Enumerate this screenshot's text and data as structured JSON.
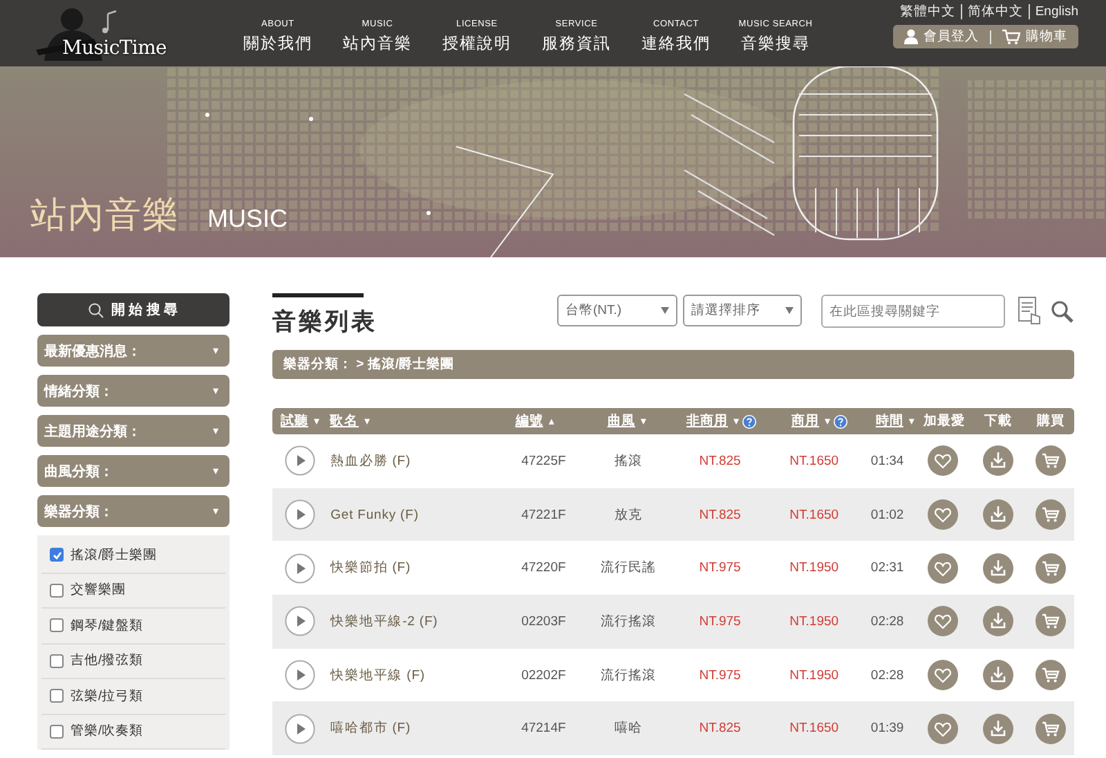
{
  "header": {
    "logo": "MusicTime",
    "nav": [
      {
        "en": "ABOUT",
        "zh": "關於我們"
      },
      {
        "en": "MUSIC",
        "zh": "站內音樂"
      },
      {
        "en": "LICENSE",
        "zh": "授權說明"
      },
      {
        "en": "SERVICE",
        "zh": "服務資訊"
      },
      {
        "en": "CONTACT",
        "zh": "連絡我們"
      },
      {
        "en": "MUSIC SEARCH",
        "zh": "音樂搜尋"
      }
    ],
    "languages": [
      "繁體中文",
      "简体中文",
      "English"
    ],
    "member": "會員登入",
    "cart": "購物車"
  },
  "banner": {
    "title": "站內音樂",
    "subtitle": "MUSIC"
  },
  "sidebar": {
    "search_button": "開 始 搜 尋",
    "categories": [
      {
        "label": "最新優惠消息：",
        "caret": "▾"
      },
      {
        "label": "情緒分類：",
        "caret": "▾"
      },
      {
        "label": "主題用途分類：",
        "caret": "▾"
      },
      {
        "label": "曲風分類：",
        "caret": "▾"
      },
      {
        "label": "樂器分類：",
        "caret": "▾"
      }
    ],
    "options": [
      {
        "label": "搖滾/爵士樂團",
        "checked": true
      },
      {
        "label": "交響樂團",
        "checked": false
      },
      {
        "label": "鋼琴/鍵盤類",
        "checked": false
      },
      {
        "label": "吉他/撥弦類",
        "checked": false
      },
      {
        "label": "弦樂/拉弓類",
        "checked": false
      },
      {
        "label": "管樂/吹奏類",
        "checked": false
      }
    ]
  },
  "main": {
    "title": "音樂列表",
    "currency": {
      "value": "台幣(NT.)"
    },
    "sort": {
      "value": "請選擇排序"
    },
    "search": {
      "placeholder": "在此區搜尋關鍵字"
    },
    "breadcrumb": "樂器分類： > 搖滾/爵士樂團",
    "columns": [
      {
        "label": "試聽",
        "arrow": "▾",
        "link": true,
        "help": false
      },
      {
        "label": "歌名",
        "arrow": "▾",
        "link": true,
        "help": false
      },
      {
        "label": "編號",
        "arrow": "▴",
        "link": true,
        "help": false
      },
      {
        "label": "曲風",
        "arrow": "▾",
        "link": true,
        "help": false
      },
      {
        "label": "非商用",
        "arrow": "▾",
        "link": true,
        "help": true
      },
      {
        "label": "商用",
        "arrow": "▾",
        "link": true,
        "help": true
      },
      {
        "label": "時間",
        "arrow": "▾",
        "link": true,
        "help": false
      },
      {
        "label": "加最愛",
        "link": false,
        "help": false
      },
      {
        "label": "下載",
        "link": false,
        "help": false
      },
      {
        "label": "購買",
        "link": false,
        "help": false
      }
    ],
    "rows": [
      {
        "name": "熱血必勝 (F)",
        "code": "47225F",
        "genre": "搖滾",
        "price_noncommercial": "NT.825",
        "price_commercial": "NT.1650",
        "time": "01:34"
      },
      {
        "name": "Get Funky (F)",
        "code": "47221F",
        "genre": "放克",
        "price_noncommercial": "NT.825",
        "price_commercial": "NT.1650",
        "time": "01:02"
      },
      {
        "name": "快樂節拍 (F)",
        "code": "47220F",
        "genre": "流行民謠",
        "price_noncommercial": "NT.975",
        "price_commercial": "NT.1950",
        "time": "02:31"
      },
      {
        "name": "快樂地平線-2 (F)",
        "code": "02203F",
        "genre": "流行搖滾",
        "price_noncommercial": "NT.975",
        "price_commercial": "NT.1950",
        "time": "02:28"
      },
      {
        "name": "快樂地平線 (F)",
        "code": "02202F",
        "genre": "流行搖滾",
        "price_noncommercial": "NT.975",
        "price_commercial": "NT.1950",
        "time": "02:28"
      },
      {
        "name": "嘻哈都市 (F)",
        "code": "47214F",
        "genre": "嘻哈",
        "price_noncommercial": "NT.825",
        "price_commercial": "NT.1650",
        "time": "01:39"
      }
    ]
  }
}
